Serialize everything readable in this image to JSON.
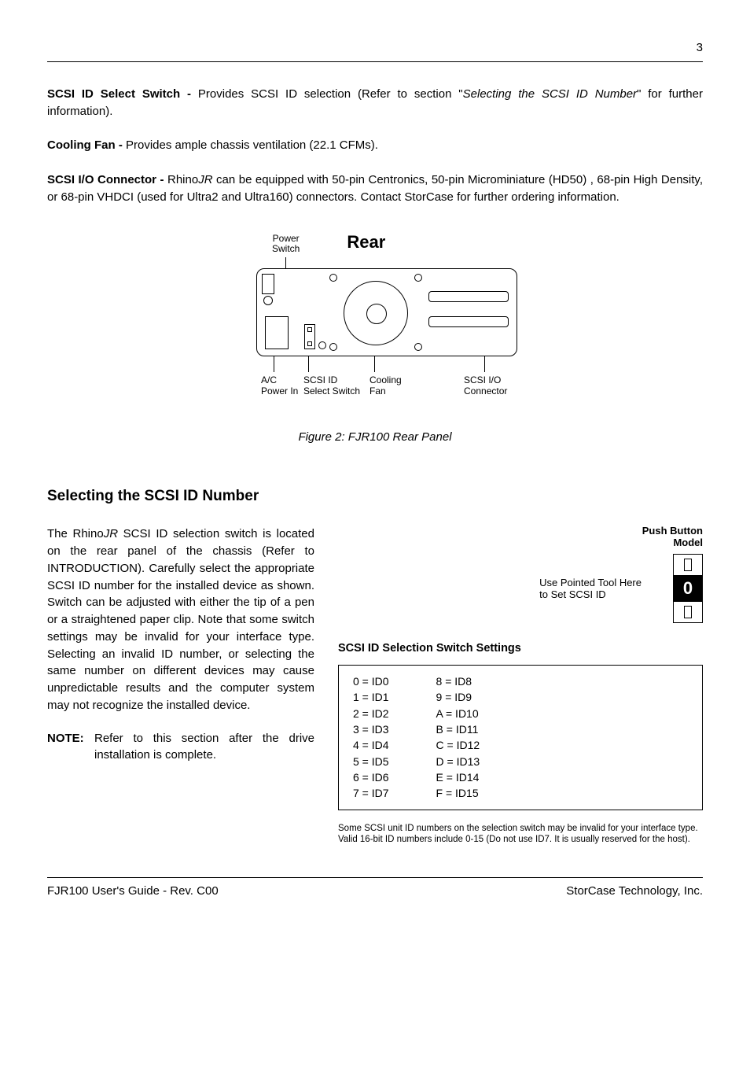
{
  "page_number": "3",
  "paragraphs": {
    "p1_bold": "SCSI ID Select Switch - ",
    "p1_text1": "Provides SCSI ID selection (Refer to section \"",
    "p1_italic": "Selecting the SCSI ID Number",
    "p1_text2": "\" for further information).",
    "p2_bold": "Cooling Fan - ",
    "p2_text": "Provides ample chassis ventilation (22.1 CFMs).",
    "p3_bold": "SCSI I/O Connector - ",
    "p3_text1": "Rhino",
    "p3_italic": "JR",
    "p3_text2": " can be equipped with 50-pin Centronics, 50-pin Microminiature (HD50) , 68-pin High Density, or 68-pin VHDCI (used for Ultra2 and Ultra160) connectors. Contact StorCase for further ordering information."
  },
  "rear_figure": {
    "power_switch": "Power\nSwitch",
    "title": "Rear",
    "labels": {
      "ac": "A/C\nPower In",
      "id": "SCSI ID\nSelect Switch",
      "fan": "Cooling\nFan",
      "conn": "SCSI I/O\nConnector"
    }
  },
  "fig_caption": "Figure 2:  FJR100 Rear Panel",
  "section_title": "Selecting the SCSI ID Number",
  "left_text1": "The Rhino",
  "left_italic": "JR",
  "left_text2": " SCSI ID selection switch is located on the rear panel of the chassis (Refer to INTRODUCTION).  Carefully select the appropriate SCSI ID number for the installed device as shown.  Switch can be adjusted with either the tip of a pen or a straightened paper clip.  Note that some switch settings may be invalid for your interface type.  Selecting an invalid ID number, or selecting the same number on different devices may cause unpredictable results and the computer system may not recognize the installed device.",
  "note_label": "NOTE:",
  "note_text": "Refer to this section after the drive installation is complete.",
  "push_button": "Push Button\nModel",
  "switch_hint": "Use Pointed Tool Here\nto Set SCSI ID",
  "switch_display": "0",
  "settings_title": "SCSI ID Selection Switch Settings",
  "settings_col1": "0 = ID0\n1 = ID1\n2 = ID2\n3 = ID3\n4 = ID4\n5 = ID5\n6 = ID6\n7 = ID7",
  "settings_col2": "8 = ID8\n9 = ID9\nA = ID10\nB = ID11\nC = ID12\nD = ID13\nE = ID14\nF = ID15",
  "footnote": "Some SCSI unit ID numbers on the selection switch may be invalid for your interface type.  Valid 16-bit ID numbers include 0-15 (Do not use ID7.  It is usually reserved for the host).",
  "footer_left": "FJR100 User's Guide - Rev. C00",
  "footer_right": "StorCase Technology, Inc."
}
